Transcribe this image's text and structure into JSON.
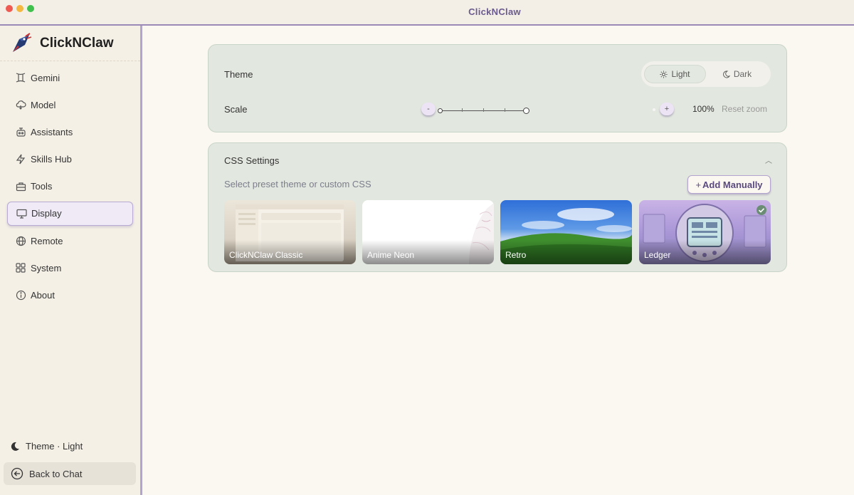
{
  "window": {
    "title": "ClickNClaw"
  },
  "brand": {
    "name": "ClickNClaw"
  },
  "sidebar": {
    "items": [
      {
        "label": "Gemini",
        "icon": "gemini-icon"
      },
      {
        "label": "Model",
        "icon": "cloud-icon"
      },
      {
        "label": "Assistants",
        "icon": "robot-icon"
      },
      {
        "label": "Skills Hub",
        "icon": "lightning-icon"
      },
      {
        "label": "Tools",
        "icon": "toolbox-icon"
      },
      {
        "label": "Display",
        "icon": "monitor-icon",
        "active": true
      },
      {
        "label": "Remote",
        "icon": "globe-icon"
      },
      {
        "label": "System",
        "icon": "grid-icon"
      },
      {
        "label": "About",
        "icon": "info-icon"
      }
    ],
    "theme_status": "Theme · Light",
    "back_label": "Back to Chat"
  },
  "theme_card": {
    "theme_label": "Theme",
    "options": [
      {
        "label": "Light",
        "icon": "sun-icon",
        "selected": true
      },
      {
        "label": "Dark",
        "icon": "moon-icon",
        "selected": false
      }
    ],
    "scale_label": "Scale",
    "minus_label": "-",
    "plus_label": "+",
    "zoom_value": "100%",
    "zoom_level": 1.0,
    "reset_label": "Reset zoom"
  },
  "css_card": {
    "title": "CSS Settings",
    "subtitle": "Select preset theme or custom CSS",
    "add_label": "Add Manually",
    "add_prefix": "+",
    "presets": [
      {
        "label": "ClickNClaw Classic",
        "selected": false
      },
      {
        "label": "Anime Neon",
        "selected": false
      },
      {
        "label": "Retro",
        "selected": false
      },
      {
        "label": "Ledger",
        "selected": true
      }
    ]
  },
  "colors": {
    "accent": "#9b89b8",
    "sidebar_bg": "#f4f0e6",
    "card_bg": "#e2e7df",
    "page_bg": "#fbf8f1",
    "add_text": "#5a4a7f",
    "check": "#6a8d74"
  }
}
